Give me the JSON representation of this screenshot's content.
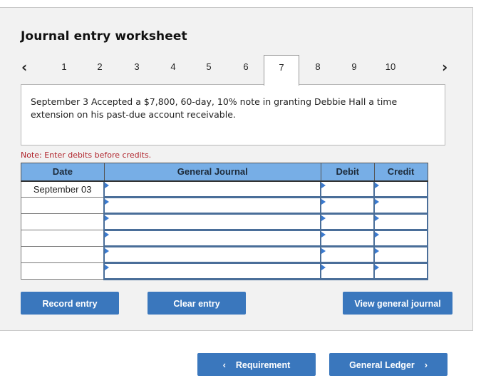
{
  "worksheet": {
    "title": "Journal entry worksheet",
    "pager": {
      "prev_icon": "chevron-left-icon",
      "next_icon": "chevron-right-icon",
      "prev_glyph": "‹",
      "next_glyph": "›",
      "tabs": [
        "1",
        "2",
        "3",
        "4",
        "5",
        "6",
        "7",
        "8",
        "9",
        "10"
      ],
      "active_tab": "7"
    },
    "description": "September 3 Accepted a $7,800, 60-day, 10% note in granting Debbie Hall a time extension on his past-due account receivable.",
    "note": "Note: Enter debits before credits.",
    "table": {
      "headers": {
        "date": "Date",
        "general_journal": "General Journal",
        "debit": "Debit",
        "credit": "Credit"
      },
      "rows": [
        {
          "date": "September 03",
          "account": "",
          "debit": "",
          "credit": ""
        },
        {
          "date": "",
          "account": "",
          "debit": "",
          "credit": ""
        },
        {
          "date": "",
          "account": "",
          "debit": "",
          "credit": ""
        },
        {
          "date": "",
          "account": "",
          "debit": "",
          "credit": ""
        },
        {
          "date": "",
          "account": "",
          "debit": "",
          "credit": ""
        },
        {
          "date": "",
          "account": "",
          "debit": "",
          "credit": ""
        }
      ]
    },
    "buttons": {
      "record": "Record entry",
      "clear": "Clear entry",
      "view": "View general journal"
    }
  },
  "nav": {
    "requirement": "Requirement",
    "requirement_glyph": "‹",
    "general_ledger": "General Ledger",
    "general_ledger_glyph": "›"
  },
  "colors": {
    "header_blue": "#77aee6",
    "button_blue": "#3a77bd",
    "note_red": "#b0242c",
    "input_border": "#4a6e99"
  }
}
